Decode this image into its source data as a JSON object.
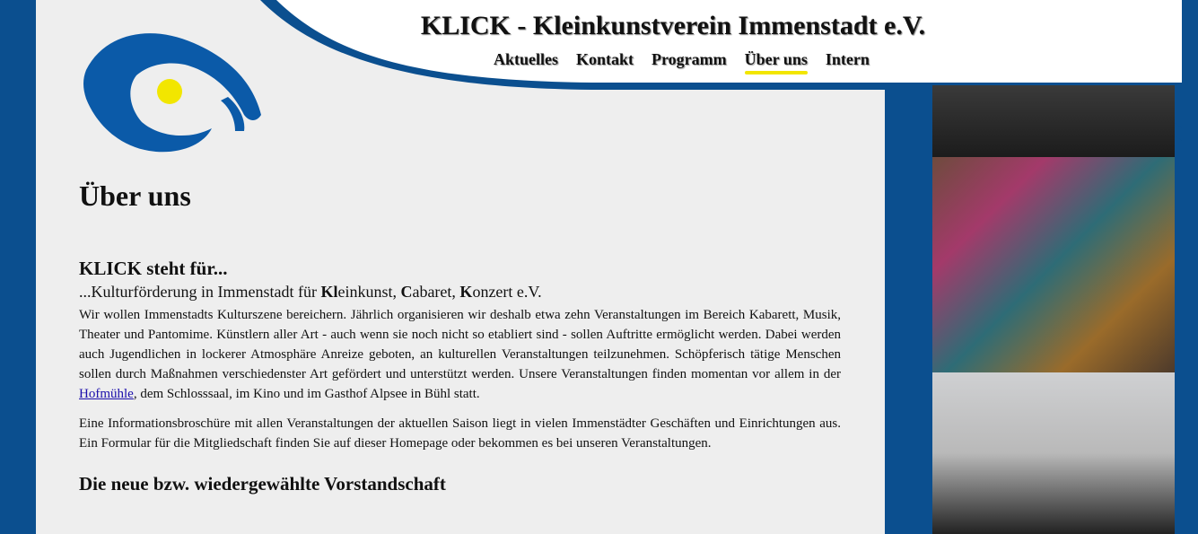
{
  "site": {
    "title": "KLICK - Kleinkunstverein Immenstadt e.V."
  },
  "colors": {
    "brand_blue": "#0b4f8f",
    "content_bg": "#eeeeee",
    "accent_yellow": "#f2e600"
  },
  "nav": {
    "items": [
      {
        "label": "Aktuelles"
      },
      {
        "label": "Kontakt"
      },
      {
        "label": "Programm"
      },
      {
        "label": "Über uns",
        "active": true
      },
      {
        "label": "Intern"
      }
    ]
  },
  "logo": {
    "icon": "eye-logo-icon"
  },
  "page": {
    "title": "Über uns",
    "section1": {
      "heading": "KLICK steht für...",
      "subhead_prefix": "...Kulturförderung in Immenstadt für ",
      "subhead_kl": "Kl",
      "subhead_kleinkunst_rest": "einkunst, ",
      "subhead_c": "C",
      "subhead_cabaret_rest": "abaret, ",
      "subhead_k": "K",
      "subhead_konzert_rest": "onzert e.V.",
      "para1_before_link": "Wir wollen Immenstadts Kulturszene bereichern. Jährlich organisieren wir deshalb etwa zehn Veranstaltungen im Bereich Kabarett, Musik, Theater und Pantomime. Künstlern aller Art - auch wenn sie noch nicht so etabliert sind - sollen Auftritte ermöglicht werden. Dabei werden auch Jugendlichen in lockerer Atmosphäre Anreize geboten, an kulturellen Veranstaltungen teilzunehmen. Schöpferisch tätige Menschen sollen durch Maßnahmen verschiedenster Art gefördert und unterstützt werden. Unsere Veranstaltungen finden momentan vor allem in der ",
      "para1_link": "Hofmühle",
      "para1_after_link": ", dem Schlosssaal, im Kino und im Gasthof Alpsee in Bühl statt.",
      "para2": "Eine Informationsbroschüre mit allen Veranstaltungen der aktuellen Saison  liegt in vielen Immenstädter Geschäften und Einrichtungen aus. Ein Formular für die Mitgliedschaft finden Sie auf dieser Homepage oder bekommen es bei unseren Veranstaltungen."
    },
    "section2": {
      "heading": "Die neue bzw. wiedergewählte Vorstandschaft"
    }
  }
}
